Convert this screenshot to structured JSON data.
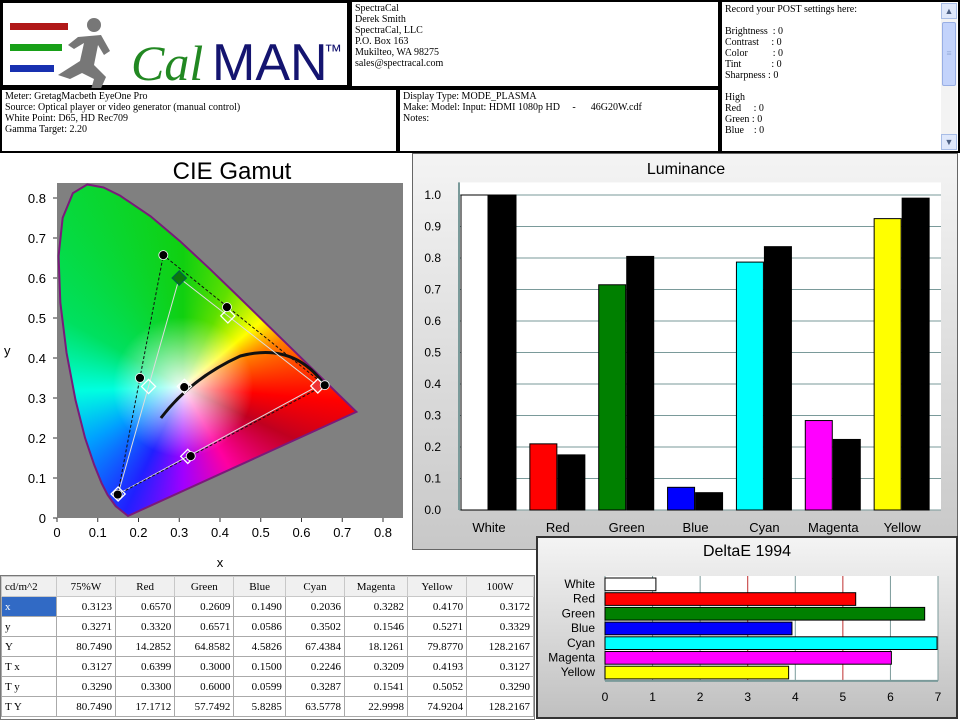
{
  "header": {
    "logo_text": "CalMAN™",
    "contact": [
      "SpectraCal",
      "Derek Smith",
      "SpectraCal, LLC",
      "P.O. Box 163",
      "Mukilteo, WA 98275",
      "sales@spectracal.com"
    ],
    "post_notes": [
      "Record your POST settings here:",
      "",
      "Brightness  : 0",
      "Contrast     : 0",
      "Color          : 0",
      "Tint            : 0",
      "Sharpness : 0",
      "",
      "High",
      "Red     : 0",
      "Green : 0",
      "Blue    : 0"
    ],
    "meter_info": [
      "Meter: GretagMacbeth EyeOne Pro",
      "Source: Optical player or video generator (manual control)",
      "White Point: D65, HD Rec709",
      "Gamma Target: 2.20"
    ],
    "display_info": [
      "Display Type: MODE_PLASMA",
      "Make: Model: Input: HDMI 1080p HD     -      46G20W.cdf",
      "Notes:"
    ]
  },
  "chart_data": [
    {
      "type": "scatter",
      "title": "CIE Gamut",
      "xlabel": "x",
      "ylabel": "y",
      "xlim": [
        0,
        0.85
      ],
      "ylim": [
        0,
        0.84
      ],
      "xticks": [
        "0",
        "0.1",
        "0.2",
        "0.3",
        "0.4",
        "0.5",
        "0.6",
        "0.7",
        "0.8"
      ],
      "yticks": [
        "0",
        "0.1",
        "0.2",
        "0.3",
        "0.4",
        "0.5",
        "0.6",
        "0.7",
        "0.8"
      ],
      "measured": {
        "White": [
          0.3123,
          0.3271
        ],
        "Red": [
          0.657,
          0.332
        ],
        "Green": [
          0.2609,
          0.6571
        ],
        "Blue": [
          0.149,
          0.0586
        ],
        "Cyan": [
          0.2036,
          0.3502
        ],
        "Magenta": [
          0.3282,
          0.1546
        ],
        "Yellow": [
          0.417,
          0.5271
        ]
      },
      "target": {
        "White": [
          0.3127,
          0.329
        ],
        "Red": [
          0.64,
          0.33
        ],
        "Green": [
          0.3,
          0.6
        ],
        "Blue": [
          0.15,
          0.06
        ],
        "Cyan": [
          0.2246,
          0.3287
        ],
        "Magenta": [
          0.3209,
          0.1541
        ],
        "Yellow": [
          0.4193,
          0.5052
        ]
      }
    },
    {
      "type": "bar",
      "title": "Luminance",
      "categories": [
        "White",
        "Red",
        "Green",
        "Blue",
        "Cyan",
        "Magenta",
        "Yellow"
      ],
      "ylim": [
        0,
        1.0
      ],
      "yticks": [
        "0.0",
        "0.1",
        "0.2",
        "0.3",
        "0.4",
        "0.5",
        "0.6",
        "0.7",
        "0.8",
        "0.9",
        "1.0"
      ],
      "series": [
        {
          "values": [
            1.0,
            0.21,
            0.715,
            0.072,
            0.787,
            0.284,
            0.925
          ],
          "colors": [
            "#ffffff",
            "#ff0000",
            "#008000",
            "#0000ff",
            "#00ffff",
            "#ff00ff",
            "#ffff00"
          ]
        },
        {
          "values": [
            1.0,
            0.175,
            0.805,
            0.055,
            0.836,
            0.224,
            0.99
          ],
          "colors": [
            "#000000"
          ]
        }
      ]
    },
    {
      "type": "bar",
      "orientation": "horizontal",
      "title": "DeltaE 1994",
      "categories": [
        "White",
        "Red",
        "Green",
        "Blue",
        "Cyan",
        "Magenta",
        "Yellow"
      ],
      "values": [
        1.07,
        5.27,
        6.72,
        3.93,
        6.98,
        6.02,
        3.86
      ],
      "colors": [
        "#ffffff",
        "#ff0000",
        "#008000",
        "#0000ff",
        "#00ffff",
        "#ff00ff",
        "#ffff00"
      ],
      "xlim": [
        0,
        7
      ],
      "xticks": [
        "0",
        "1",
        "2",
        "3",
        "4",
        "5",
        "6",
        "7"
      ],
      "reference_lines": [
        3,
        5
      ]
    }
  ],
  "table": {
    "headers": [
      "cd/m^2",
      "75%W",
      "Red",
      "Green",
      "Blue",
      "Cyan",
      "Magenta",
      "Yellow",
      "100W"
    ],
    "rows": [
      [
        "x",
        "0.3123",
        "0.6570",
        "0.2609",
        "0.1490",
        "0.2036",
        "0.3282",
        "0.4170",
        "0.3172"
      ],
      [
        "y",
        "0.3271",
        "0.3320",
        "0.6571",
        "0.0586",
        "0.3502",
        "0.1546",
        "0.5271",
        "0.3329"
      ],
      [
        "Y",
        "80.7490",
        "14.2852",
        "64.8582",
        "4.5826",
        "67.4384",
        "18.1261",
        "79.8770",
        "128.2167"
      ],
      [
        "T x",
        "0.3127",
        "0.6399",
        "0.3000",
        "0.1500",
        "0.2246",
        "0.3209",
        "0.4193",
        "0.3127"
      ],
      [
        "T y",
        "0.3290",
        "0.3300",
        "0.6000",
        "0.0599",
        "0.3287",
        "0.1541",
        "0.5052",
        "0.3290"
      ],
      [
        "T Y",
        "80.7490",
        "17.1712",
        "57.7492",
        "5.8285",
        "63.5778",
        "22.9998",
        "74.9204",
        "128.2167"
      ]
    ]
  }
}
